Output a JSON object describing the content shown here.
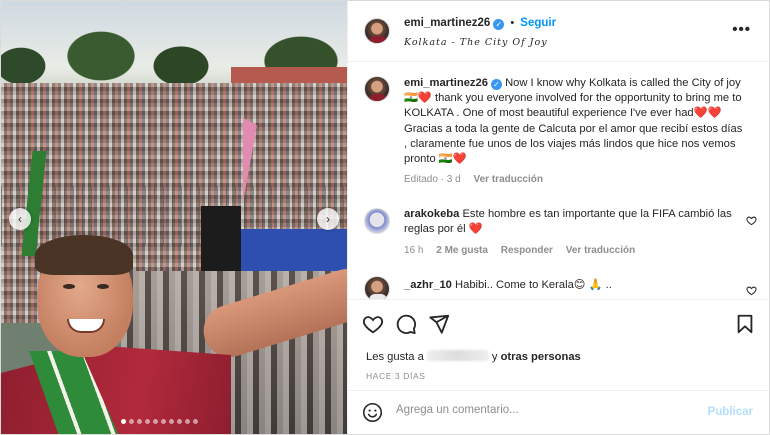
{
  "header": {
    "username": "emi_martinez26",
    "follow_label": "Seguir",
    "separator": "•",
    "location": "Kolkata - The City Of Joy",
    "more_icon": "more-horizontal-icon"
  },
  "caption": {
    "username": "emi_martinez26",
    "text": "Now I know why Kolkata is called the City of joy 🇮🇳❤️ thank you everyone involved for the opportunity to bring me to KOLKATA . One of most beautiful experience I've ever had❤️❤️ Gracias a toda la gente de Calcuta por el amor que recibí estos días , claramente fue unos de los viajes más lindos que hice nos vemos pronto 🇮🇳❤️",
    "edited": "Editado · 3 d",
    "see_translation": "Ver traducción"
  },
  "comments": [
    {
      "username": "arakokeba",
      "text": "Este hombre es tan importante que la FIFA cambió las reglas por él ❤️",
      "age": "16 h",
      "likes": "2 Me gusta",
      "reply": "Responder",
      "see_translation": "Ver traducción"
    },
    {
      "username": "_azhr_10",
      "text": "Habibi.. Come to Kerala😊 🙏 .."
    }
  ],
  "likes": {
    "prefix": "Les gusta a",
    "suffix": "otras personas",
    "connector": "y"
  },
  "time_ago": "HACE 3 DÍAS",
  "add_comment": {
    "placeholder": "Agrega un comentario...",
    "publish_label": "Publicar"
  },
  "carousel": {
    "prev_label": "‹",
    "next_label": "›",
    "slide_count": 10,
    "active_slide": 1
  },
  "colors": {
    "link_blue": "#0095f6",
    "verified_blue": "#3897f0",
    "publish_disabled": "#b2dffc",
    "muted_text": "#8e8e8e"
  }
}
